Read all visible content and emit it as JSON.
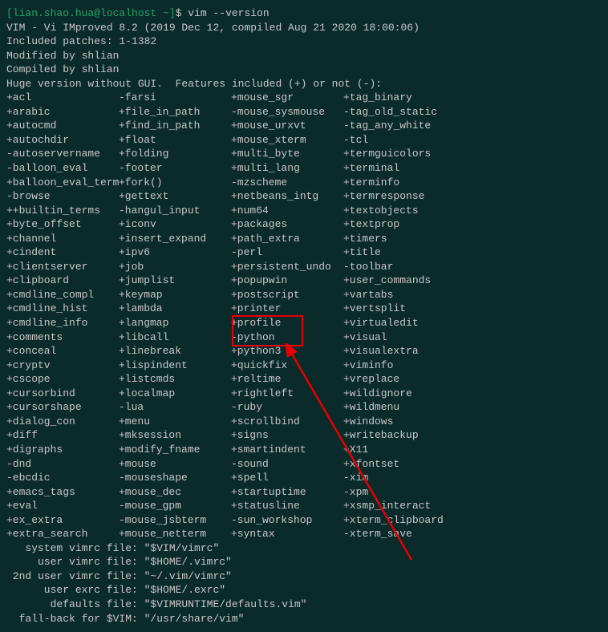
{
  "prompt": {
    "user_host": "[lian.shao.hua@localhost ~]",
    "dollar": "$",
    "command": "vim --version"
  },
  "headers": [
    "VIM - Vi IMproved 8.2 (2019 Dec 12, compiled Aug 21 2020 18:00:06)",
    "Included patches: 1-1382",
    "Modified by shlian",
    "Compiled by shlian",
    "Huge version without GUI.  Features included (+) or not (-):"
  ],
  "features_cols": {
    "col1": [
      "+acl",
      "+arabic",
      "+autocmd",
      "+autochdir",
      "-autoservername",
      "-balloon_eval",
      "+balloon_eval_term",
      "-browse",
      "++builtin_terms",
      "+byte_offset",
      "+channel",
      "+cindent",
      "+clientserver",
      "+clipboard",
      "+cmdline_compl",
      "+cmdline_hist",
      "+cmdline_info",
      "+comments",
      "+conceal",
      "+cryptv",
      "+cscope",
      "+cursorbind",
      "+cursorshape",
      "+dialog_con",
      "+diff",
      "+digraphs",
      "-dnd",
      "-ebcdic",
      "+emacs_tags",
      "+eval",
      "+ex_extra",
      "+extra_search"
    ],
    "col2": [
      "-farsi",
      "+file_in_path",
      "+find_in_path",
      "+float",
      "+folding",
      "-footer",
      "+fork()",
      "+gettext",
      "-hangul_input",
      "+iconv",
      "+insert_expand",
      "+ipv6",
      "+job",
      "+jumplist",
      "+keymap",
      "+lambda",
      "+langmap",
      "+libcall",
      "+linebreak",
      "+lispindent",
      "+listcmds",
      "+localmap",
      "-lua",
      "+menu",
      "+mksession",
      "+modify_fname",
      "+mouse",
      "-mouseshape",
      "+mouse_dec",
      "-mouse_gpm",
      "-mouse_jsbterm",
      "+mouse_netterm"
    ],
    "col3": [
      "+mouse_sgr",
      "-mouse_sysmouse",
      "+mouse_urxvt",
      "+mouse_xterm",
      "+multi_byte",
      "+multi_lang",
      "-mzscheme",
      "+netbeans_intg",
      "+num64",
      "+packages",
      "+path_extra",
      "-perl",
      "+persistent_undo",
      "+popupwin",
      "+postscript",
      "+printer",
      "+profile",
      "-python",
      "+python3",
      "+quickfix",
      "+reltime",
      "+rightleft",
      "-ruby",
      "+scrollbind",
      "+signs",
      "+smartindent",
      "-sound",
      "+spell",
      "+startuptime",
      "+statusline",
      "-sun_workshop",
      "+syntax"
    ],
    "col4": [
      "+tag_binary",
      "-tag_old_static",
      "-tag_any_white",
      "-tcl",
      "+termguicolors",
      "+terminal",
      "+terminfo",
      "+termresponse",
      "+textobjects",
      "+textprop",
      "+timers",
      "+title",
      "-toolbar",
      "+user_commands",
      "+vartabs",
      "+vertsplit",
      "+virtualedit",
      "+visual",
      "+visualextra",
      "+viminfo",
      "+vreplace",
      "+wildignore",
      "+wildmenu",
      "+windows",
      "+writebackup",
      "+X11",
      "+xfontset",
      "-xim",
      "-xpm",
      "+xsmp_interact",
      "+xterm_clipboard",
      "-xterm_save"
    ]
  },
  "footer": [
    "   system vimrc file: \"$VIM/vimrc\"",
    "     user vimrc file: \"$HOME/.vimrc\"",
    " 2nd user vimrc file: \"~/.vim/vimrc\"",
    "      user exrc file: \"$HOME/.exrc\"",
    "       defaults file: \"$VIMRUNTIME/defaults.vim\"",
    "  fall-back for $VIM: \"/usr/share/vim\""
  ]
}
